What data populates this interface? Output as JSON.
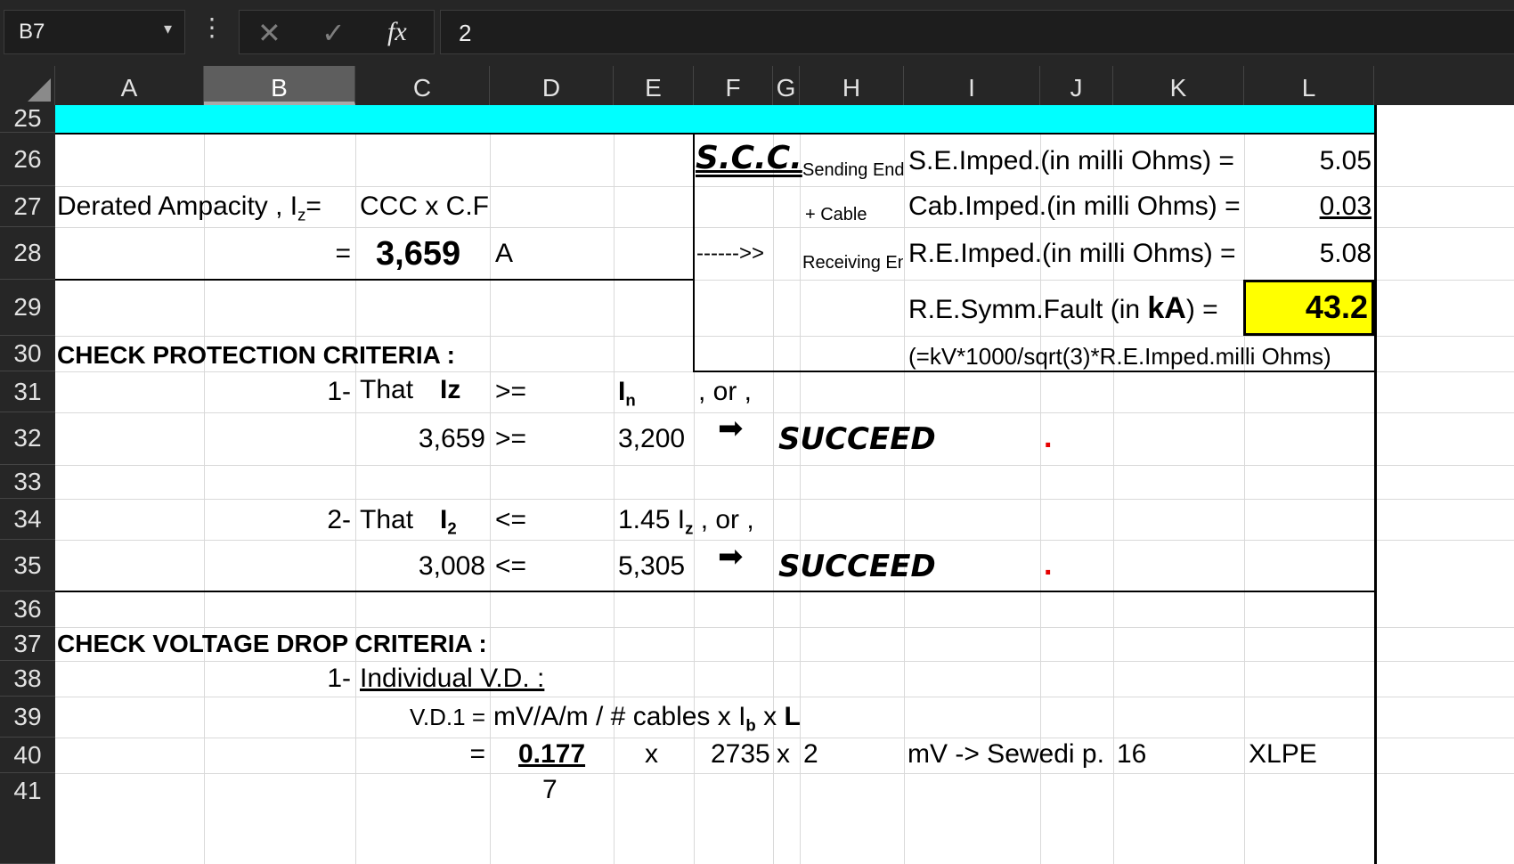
{
  "formula_bar": {
    "name_box": "B7",
    "name_box_arrow": "▾",
    "dots": "⋮",
    "cancel_icon": "✕",
    "enter_icon": "✓",
    "fx_label": "fx",
    "value": "2"
  },
  "columns": [
    "A",
    "B",
    "C",
    "D",
    "E",
    "F",
    "G",
    "H",
    "I",
    "J",
    "K",
    "L"
  ],
  "selected_column": "B",
  "rows": [
    "25",
    "26",
    "27",
    "28",
    "29",
    "30",
    "31",
    "32",
    "33",
    "34",
    "35",
    "36",
    "37",
    "38",
    "39",
    "40",
    "41"
  ],
  "cells": {
    "derated_label": "Derated Ampacity , I",
    "derated_sub": "z",
    "derated_eq": "=",
    "ccc_cf": "CCC x C.F",
    "eq28": "=",
    "iz_value": "3,659",
    "unit_a": "A",
    "scc_title": "S.C.C.",
    "sending_end": "Sending End",
    "plus_cable": "+ Cable",
    "arrow_text": "------>>",
    "receiving_end": "Receiving Enc",
    "se_imped_label": "S.E.Imped.(in milli Ohms) =",
    "se_imped_value": "5.05",
    "cab_imped_label": "Cab.Imped.(in milli Ohms) =",
    "cab_imped_value": "0.03",
    "re_imped_label": "R.E.Imped.(in milli Ohms) =",
    "re_imped_value": "5.08",
    "fault_label_a": "R.E.Symm.Fault  (in ",
    "fault_label_ka": "kA",
    "fault_label_b": ") =",
    "fault_value": "43.2",
    "fault_formula": "(=kV*1000/sqrt(3)*R.E.Imped.milli Ohms)",
    "check_protection": "CHECK PROTECTION CRITERIA :",
    "c1_num": "1-",
    "c1_that": "That",
    "c1_iz": "Iz",
    "c1_op": ">=",
    "c1_in": "I",
    "c1_in_sub": "n",
    "c1_or": ", or ,",
    "c1_left": "3,659",
    "c1_op2": ">=",
    "c1_right": "3,200",
    "c1_arrow": "➡",
    "c1_result": "SUCCEED",
    "c1_dot": ".",
    "c2_num": "2-",
    "c2_that": "That",
    "c2_i2": "I",
    "c2_i2_sub": "2",
    "c2_op": "<=",
    "c2_rhs": "1.45 I",
    "c2_rhs_sub": "z",
    "c2_or": " , or ,",
    "c2_left": "3,008",
    "c2_op2": "<=",
    "c2_right": "5,305",
    "c2_arrow": "➡",
    "c2_result": "SUCCEED",
    "c2_dot": ".",
    "check_voltage": "CHECK VOLTAGE DROP CRITERIA :",
    "vd_num": "1-",
    "vd_title": "Individual V.D. :",
    "vd1_label": "V.D.1 =",
    "vd1_formula_a": "mV/A/m / # cables x I",
    "vd1_formula_sub": "b",
    "vd1_formula_b": " x ",
    "vd1_formula_l": "L",
    "r40_eq": "=",
    "r40_val": "0.177",
    "r40_x1": "x",
    "r40_ib": "2735",
    "r40_x2": "x",
    "r40_cables": "2",
    "r40_src": "mV -> Sewedi p.",
    "r40_page": "16",
    "r40_type": "XLPE",
    "r41_val": "7"
  },
  "colors": {
    "cyan_band": "#00ffff",
    "fault_fill": "#ffff00",
    "success_dot": "#e60000",
    "chrome": "#262626"
  }
}
